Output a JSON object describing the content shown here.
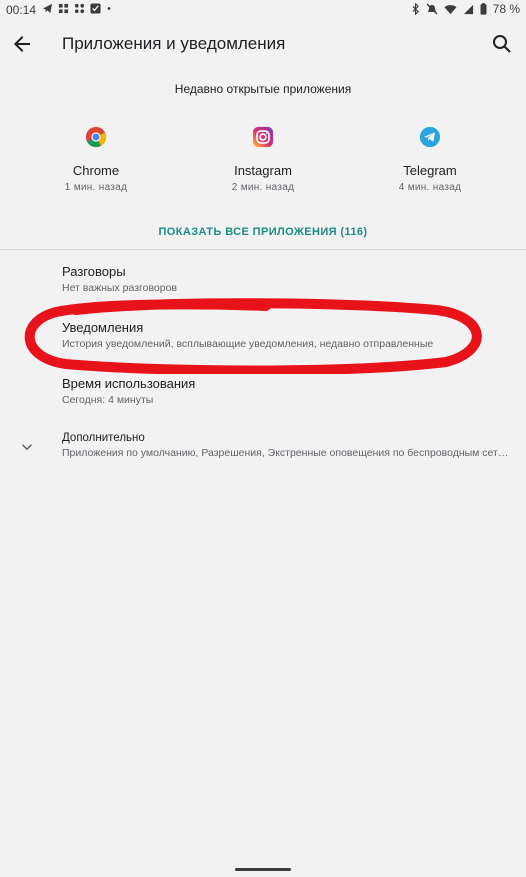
{
  "status": {
    "time": "00:14",
    "battery": "78 %"
  },
  "header": {
    "title": "Приложения и уведомления"
  },
  "recent": {
    "title": "Недавно открытые приложения",
    "apps": [
      {
        "name": "Chrome",
        "time": "1 мин. назад",
        "icon": "chrome-icon"
      },
      {
        "name": "Instagram",
        "time": "2 мин. назад",
        "icon": "instagram-icon"
      },
      {
        "name": "Telegram",
        "time": "4 мин. назад",
        "icon": "telegram-icon"
      }
    ],
    "show_all": "ПОКАЗАТЬ ВСЕ ПРИЛОЖЕНИЯ (116)"
  },
  "settings": [
    {
      "title": "Разговоры",
      "subtitle": "Нет важных разговоров"
    },
    {
      "title": "Уведомления",
      "subtitle": "История уведомлений, всплывающие уведомления, недавно отправленные"
    },
    {
      "title": "Время использования",
      "subtitle": "Сегодня: 4 минуты"
    },
    {
      "title": "Дополнительно",
      "subtitle": "Приложения по умолчанию, Разрешения, Экстренные оповещения по беспроводным сетям, Специальный доступ"
    }
  ],
  "colors": {
    "accent": "#1a8a84",
    "annotation": "#e8121b"
  }
}
